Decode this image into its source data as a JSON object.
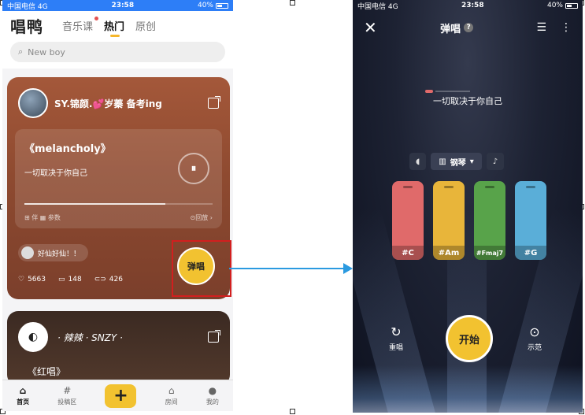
{
  "left": {
    "status": {
      "carrier": "中国电信 4G",
      "time": "23:58",
      "battery": "40%"
    },
    "logo": "唱鸭",
    "tabs": [
      {
        "label": "音乐课"
      },
      {
        "label": "热门"
      },
      {
        "label": "原创"
      }
    ],
    "search_placeholder": "New boy",
    "card1": {
      "username": "SY.锦颜.💕岁蓁 备考ing",
      "song_title": "《melancholy》",
      "lyric": "一切取决于你自己",
      "pause_icon": "⏸",
      "progress": 0.75,
      "foot_left": "⊞ 伴 ▦ 参数",
      "foot_right": "⊙回放 ›",
      "comment": "好仙好仙！！",
      "likes": "5663",
      "comments": "148",
      "shares": "426",
      "sing_button": "弹唱"
    },
    "card2": {
      "username": "· 辣辣 · SNZY ·",
      "title": "《红唱》"
    },
    "nav": [
      {
        "label": "首页",
        "icon": "⌂"
      },
      {
        "label": "投稿区",
        "icon": "#"
      },
      {
        "label": "",
        "icon": "+"
      },
      {
        "label": "房间",
        "icon": "⌂"
      },
      {
        "label": "我的",
        "icon": "●"
      }
    ]
  },
  "right": {
    "status": {
      "carrier": "中国电信 4G",
      "time": "23:58",
      "battery": "40%"
    },
    "title": "弹唱",
    "help_icon": "?",
    "lyric": "一切取决于你自己",
    "instrument": "钢琴",
    "chords": [
      {
        "label": "#C",
        "color": "#e06a6a"
      },
      {
        "label": "#Am",
        "color": "#e8b53a"
      },
      {
        "label": "#Fmaj7",
        "color": "#58a34a"
      },
      {
        "label": "#G",
        "color": "#5aaed8"
      }
    ],
    "restart_label": "重唱",
    "start_label": "开始",
    "demo_label": "示范"
  },
  "colors": {
    "accent": "#f2c230",
    "arrow": "#2b9ae0",
    "highlight": "#d21f1f"
  }
}
